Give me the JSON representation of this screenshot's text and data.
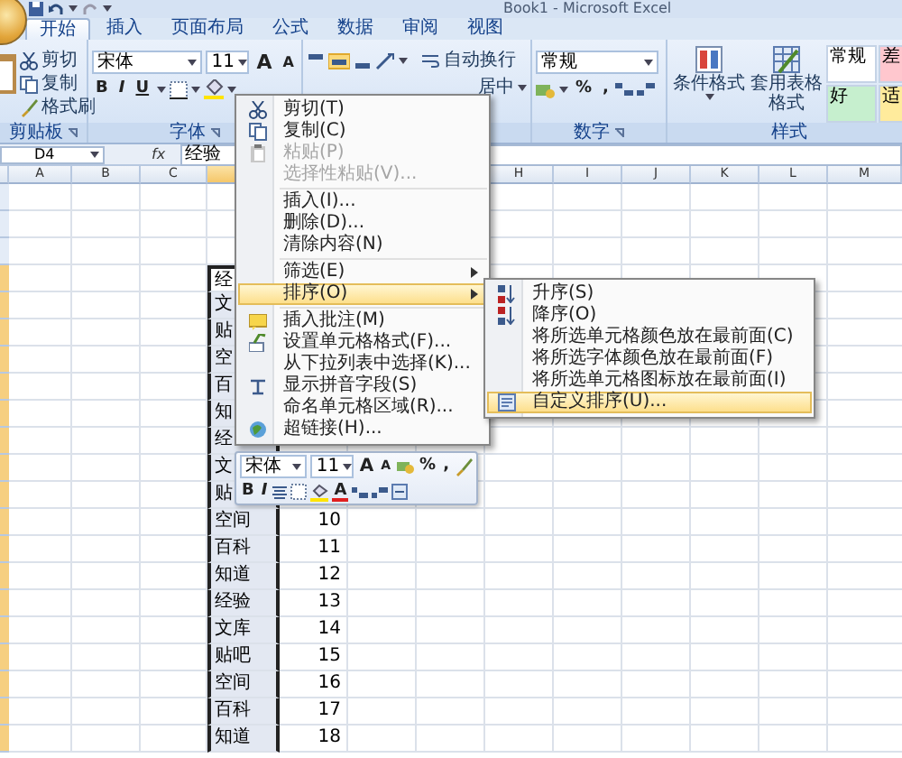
{
  "window": {
    "title": "Book1 - Microsoft Excel"
  },
  "tabs": [
    {
      "label": "开始",
      "selected": true
    },
    {
      "label": "插入",
      "selected": false
    },
    {
      "label": "页面布局",
      "selected": false
    },
    {
      "label": "公式",
      "selected": false
    },
    {
      "label": "数据",
      "selected": false
    },
    {
      "label": "审阅",
      "selected": false
    },
    {
      "label": "视图",
      "selected": false
    }
  ],
  "ribbon": {
    "clipboard": {
      "buttons": [
        "剪切",
        "复制",
        "格式刷"
      ],
      "label": "剪贴板"
    },
    "font": {
      "font_name": "宋体",
      "font_size": "11",
      "grow": "A",
      "shrink": "A",
      "style_buttons": [
        "B",
        "I",
        "U"
      ],
      "label": "字体"
    },
    "alignment": {
      "wrap_text": "自动换行",
      "merge_center": "居中"
    },
    "number": {
      "format": "常规",
      "percent": "%",
      "comma": ",",
      "label": "数字"
    },
    "styles": {
      "conditional_format": "条件格式",
      "format_as_table": "套用表格格式",
      "cell_styles": [
        {
          "label": "常规",
          "color": "#ffffff"
        },
        {
          "label": "差",
          "color": "#ffc7ce"
        },
        {
          "label": "好",
          "color": "#c6efce"
        },
        {
          "label": "适",
          "color": "#ffeb9c"
        }
      ],
      "label": "样式"
    }
  },
  "formula_bar": {
    "name_box": "D4",
    "function_label": "fx",
    "value": "经验"
  },
  "sheet": {
    "columns": [
      {
        "label": "A",
        "selected": false
      },
      {
        "label": "B",
        "selected": false
      },
      {
        "label": "C",
        "selected": false
      },
      {
        "selected": true
      },
      {},
      {},
      {},
      {
        "label": "H",
        "selected": false
      },
      {
        "label": "I",
        "selected": false
      },
      {
        "label": "J",
        "selected": false
      },
      {
        "label": "K",
        "selected": false
      },
      {
        "label": "L",
        "selected": false
      },
      {
        "label": "M",
        "selected": false
      }
    ],
    "rows": [
      {
        "selected": false
      },
      {
        "selected": false
      },
      {
        "selected": false
      },
      {
        "selected": true,
        "column_d": "经"
      },
      {
        "selected": true,
        "column_d": "文"
      },
      {
        "selected": true,
        "column_d": "贴"
      },
      {
        "selected": true,
        "column_d": "空"
      },
      {
        "selected": true,
        "column_d": "百"
      },
      {
        "selected": true,
        "column_d": "知"
      },
      {
        "selected": true,
        "column_d": "经"
      },
      {
        "selected": true,
        "column_d": "文"
      },
      {
        "selected": true,
        "column_d": "贴"
      },
      {
        "selected": true,
        "column_d": "空间",
        "column_e": "10"
      },
      {
        "selected": true,
        "column_d": "百科",
        "column_e": "11"
      },
      {
        "selected": true,
        "column_d": "知道",
        "column_e": "12"
      },
      {
        "selected": true,
        "column_d": "经验",
        "column_e": "13"
      },
      {
        "selected": true,
        "column_d": "文库",
        "column_e": "14"
      },
      {
        "selected": true,
        "column_d": "贴吧",
        "column_e": "15"
      },
      {
        "selected": true,
        "column_d": "空间",
        "column_e": "16"
      },
      {
        "selected": true,
        "column_d": "百科",
        "column_e": "17"
      },
      {
        "selected": true,
        "column_d": "知道",
        "column_e": "18"
      }
    ]
  },
  "context_menu": {
    "items": [
      {
        "kind": "item",
        "label": "剪切(T)",
        "disabled": false,
        "submenu": false,
        "selected": false
      },
      {
        "kind": "item",
        "label": "复制(C)",
        "disabled": false,
        "submenu": false,
        "selected": false
      },
      {
        "kind": "item",
        "label": "粘贴(P)",
        "disabled": true,
        "submenu": false,
        "selected": false
      },
      {
        "kind": "item",
        "label": "选择性粘贴(V)...",
        "disabled": true,
        "submenu": false,
        "selected": false
      },
      {
        "kind": "separator"
      },
      {
        "kind": "item",
        "label": "插入(I)...",
        "disabled": false,
        "submenu": false,
        "selected": false
      },
      {
        "kind": "item",
        "label": "删除(D)...",
        "disabled": false,
        "submenu": false,
        "selected": false
      },
      {
        "kind": "item",
        "label": "清除内容(N)",
        "disabled": false,
        "submenu": false,
        "selected": false
      },
      {
        "kind": "separator"
      },
      {
        "kind": "item",
        "label": "筛选(E)",
        "disabled": false,
        "submenu": true,
        "selected": false
      },
      {
        "kind": "item",
        "label": "排序(O)",
        "disabled": false,
        "submenu": true,
        "selected": true
      },
      {
        "kind": "separator"
      },
      {
        "kind": "item",
        "label": "插入批注(M)",
        "disabled": false,
        "submenu": false,
        "selected": false
      },
      {
        "kind": "item",
        "label": "设置单元格格式(F)...",
        "disabled": false,
        "submenu": false,
        "selected": false
      },
      {
        "kind": "item",
        "label": "从下拉列表中选择(K)...",
        "disabled": false,
        "submenu": false,
        "selected": false
      },
      {
        "kind": "item",
        "label": "显示拼音字段(S)",
        "disabled": false,
        "submenu": false,
        "selected": false
      },
      {
        "kind": "item",
        "label": "命名单元格区域(R)...",
        "disabled": false,
        "submenu": false,
        "selected": false
      },
      {
        "kind": "item",
        "label": "超链接(H)...",
        "disabled": false,
        "submenu": false,
        "selected": false
      }
    ]
  },
  "sort_submenu": {
    "items": [
      {
        "label": "升序(S)",
        "selected": false
      },
      {
        "label": "降序(O)",
        "selected": false
      },
      {
        "label": "将所选单元格颜色放在最前面(C)",
        "selected": false
      },
      {
        "label": "将所选字体颜色放在最前面(F)",
        "selected": false
      },
      {
        "label": "将所选单元格图标放在最前面(I)",
        "selected": false
      },
      {
        "label": "自定义排序(U)...",
        "selected": true
      }
    ]
  },
  "mini_toolbar": {
    "font_name": "宋体",
    "font_size": "11",
    "grow": "A",
    "shrink": "A",
    "percent": "%",
    "comma": ",",
    "style_buttons": [
      "B",
      "I"
    ],
    "font_color": "A"
  }
}
